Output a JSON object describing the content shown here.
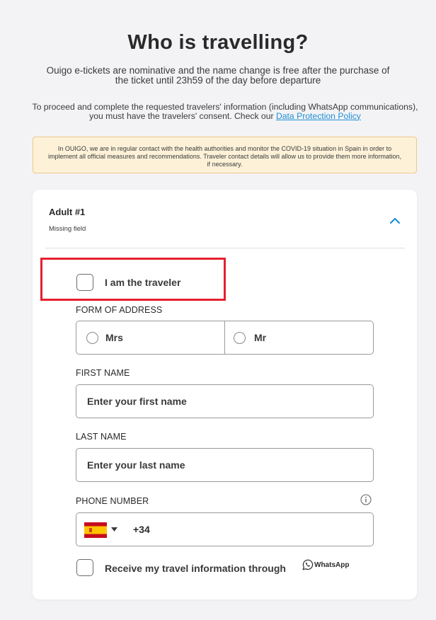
{
  "header": {
    "title": "Who is travelling?",
    "subtitle": "Ouigo e-tickets are nominative and the name change is free after the purchase of the ticket until 23h59 of the day before departure",
    "consent_text": "To proceed and complete the requested travelers' information (including WhatsApp communications), you must have the travelers' consent. Check our",
    "consent_link": "Data Protection Policy"
  },
  "notice": {
    "text": "In OUIGO, we are in regular contact with the health authorities and monitor the COVID-19 situation in Spain in order to implement all official measures and recommendations. Traveler contact details will allow us to provide them more information, if necessary."
  },
  "traveler_card": {
    "title": "Adult #1",
    "status": "Missing field",
    "i_am_traveler_label": "I am the traveler",
    "form_of_address": {
      "label": "FORM OF ADDRESS",
      "options": [
        "Mrs",
        "Mr"
      ]
    },
    "first_name": {
      "label": "FIRST NAME",
      "placeholder": "Enter your first name"
    },
    "last_name": {
      "label": "LAST NAME",
      "placeholder": "Enter your last name"
    },
    "phone": {
      "label": "PHONE NUMBER",
      "country_flag": "spain-flag-icon",
      "dial_code": "+34"
    },
    "whatsapp_optin": {
      "label": "Receive my travel information through",
      "brand": "WhatsApp"
    }
  },
  "colors": {
    "accent": "#1f8fd8",
    "highlight": "#e5202f",
    "notice_bg": "#fdf1d8",
    "notice_border": "#ecc98a"
  }
}
